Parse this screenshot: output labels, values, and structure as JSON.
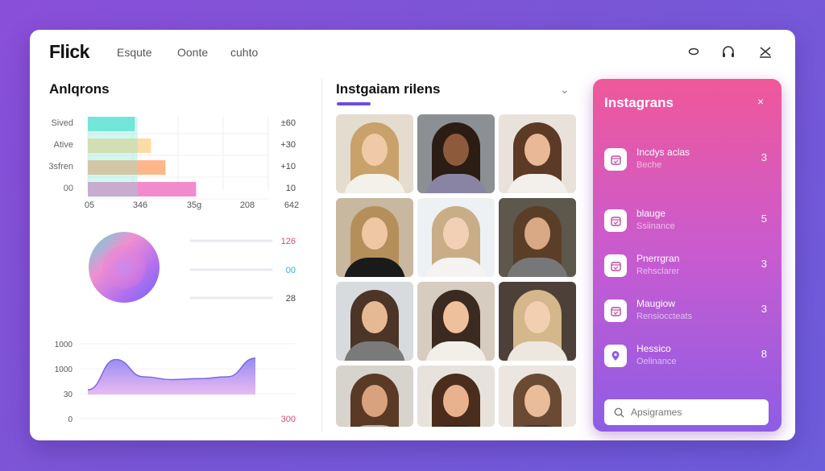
{
  "header": {
    "logo": "Flick",
    "nav": [
      "Esqute",
      "Oonte",
      "cuhto"
    ],
    "icons": [
      "record-icon",
      "headset-icon",
      "antenna-icon"
    ]
  },
  "left": {
    "title": "Anlqrons"
  },
  "chart_data": [
    {
      "type": "bar",
      "orientation": "horizontal",
      "categories": [
        "Sived",
        "Ative",
        "3sfren",
        "00"
      ],
      "x_ticks": [
        "05",
        "346",
        "35g",
        "208",
        "642"
      ],
      "right_labels": [
        "±60",
        "+30",
        "+10",
        "10"
      ],
      "values": [
        26,
        35,
        43,
        60
      ],
      "grid": true,
      "colors": [
        "#5fe0d6",
        "#ffd79a",
        "#ffae7d",
        "#f07ec8"
      ]
    },
    {
      "type": "pie",
      "labels": [
        "",
        "",
        ""
      ],
      "values": [
        126,
        0,
        28
      ],
      "value_labels": [
        "126",
        "00",
        "28"
      ],
      "label_colors": [
        "#e24a6e",
        "#26b9c9",
        "#444444"
      ]
    },
    {
      "type": "area",
      "y_ticks": [
        "1000",
        "1000",
        "30",
        "0"
      ],
      "right_label": "300",
      "values": [
        10,
        75,
        38,
        32,
        34,
        38,
        78
      ],
      "grid": true
    }
  ],
  "middle": {
    "title": "Instgaiam rilens",
    "photos": 12
  },
  "right": {
    "title": "Instagrans",
    "close": "×",
    "items": [
      {
        "icon": "calendar-icon",
        "title": "Incdys aclas",
        "sub": "Beche",
        "count": "3"
      },
      {
        "icon": "calendar-icon",
        "title": "blauge",
        "sub": "Ssiinance",
        "count": "5"
      },
      {
        "icon": "calendar-icon",
        "title": "Pnerrgran",
        "sub": "Rehsclarer",
        "count": "3"
      },
      {
        "icon": "calendar-check-icon",
        "title": "Maugiow",
        "sub": "Rensioccteats",
        "count": "3"
      },
      {
        "icon": "location-pin-icon",
        "title": "Hessico",
        "sub": "Oelinance",
        "count": "8"
      }
    ],
    "search_placeholder": "Apsigrames"
  }
}
